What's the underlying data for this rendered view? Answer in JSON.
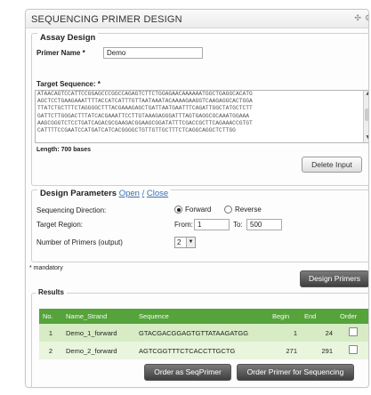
{
  "panel": {
    "title": "SEQUENCING PRIMER DESIGN"
  },
  "assay": {
    "legend": "Assay Design",
    "primer_name_label": "Primer Name *",
    "primer_name_value": "Demo",
    "target_sequence_label": "Target Sequence: *",
    "sequence_lines": [
      "ATAACAGTCCATTCCGGAGCCCGGCCAGAGTCTTCTGGAGAACAAAAAATGGCTGAGGCACATG",
      "AGCTCCTGAAGAAATTTTACCATCATTTGTTAATAAATACAAAAGAAGGTCAAGAGGCACTGGA",
      "TTATCTGCTTTCTAGGGGCTTTACGAAAGAGCTGATTAATGAATTTCAGATTGGCTATGCTCTT",
      "GATTCTTGGGACTTTATCACGAAATTCCTTGTAAAGAGGGATTTAGTGAGGCGCAAATGGAAA",
      "AAGCGGGTCTCCTGATCAGACGCGAAGACGGAAGCGGATATTTCGACCGCTTCAGAAACCGTGT",
      "CATTTTCCGAATCCATGATCATCACGGGGCTGTTGTTGCTTTCTCAGGCAGGCTCTTGG"
    ],
    "length_label": "Length: 700 bases",
    "delete_button": "Delete Input"
  },
  "design": {
    "legend": "Design Parameters",
    "open_link": "Open",
    "separator": "/",
    "close_link": "Close",
    "direction_label": "Sequencing Direction:",
    "forward_label": "Forward",
    "reverse_label": "Reverse",
    "direction_selected": "Forward",
    "target_region_label": "Target Region:",
    "from_label": "From:",
    "from_value": "1",
    "to_label": "To:",
    "to_value": "500",
    "num_primers_label": "Number of Primers (output)",
    "num_primers_value": "2",
    "num_primers_arrow": "▼"
  },
  "mandatory_note": "* mandatory",
  "design_primers_button": "Design Primers",
  "results": {
    "legend": "Results",
    "columns": [
      "No.",
      "Name_Strand",
      "Sequence",
      "Begin",
      "End",
      "Order"
    ],
    "rows": [
      {
        "no": "1",
        "name": "Demo_1_forward",
        "sequence": "GTACGACGGAGTGTTATAAGATGG",
        "begin": "1",
        "end": "24"
      },
      {
        "no": "2",
        "name": "Demo_2_forward",
        "sequence": "AGTCGGTTTCTCACCTTGCTG",
        "begin": "271",
        "end": "291"
      }
    ],
    "order_seqprimer_button": "Order as SeqPrimer",
    "order_sequencing_button": "Order Primer for Sequencing"
  },
  "icons": {
    "move": "move-icon",
    "settings": "gear-icon"
  },
  "colors": {
    "results_header": "#55a33a",
    "row_odd": "#d7ecc5",
    "row_even": "#e9f5dd",
    "link": "#3a6fb0"
  }
}
